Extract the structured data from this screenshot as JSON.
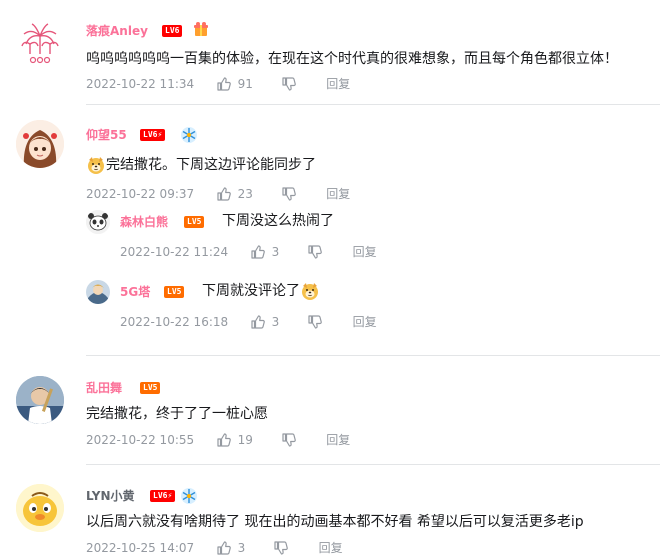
{
  "colors": {
    "username_pink": "#fb7299",
    "username_grey": "#61666d",
    "meta": "#9499a0",
    "lv6": "#ff0000",
    "lv5": "#ff6c00"
  },
  "comments": [
    {
      "user": "落痕Anley",
      "level": "LV6",
      "text": "呜呜呜呜呜呜一百集的体验，在现在这个时代真的很难想象，而且每个角色都很立体！",
      "time": "2022-10-22 11:34",
      "likes": "91",
      "reply": "回复"
    },
    {
      "user": "仰望55",
      "level": "LV6",
      "text": "完结撒花。下周这边评论能同步了",
      "time": "2022-10-22 09:37",
      "likes": "23",
      "reply": "回复",
      "replies": [
        {
          "user": "森林白熊",
          "level": "LV5",
          "text": "下周没这么热闹了",
          "time": "2022-10-22 11:24",
          "likes": "3",
          "reply": "回复"
        },
        {
          "user": "5G塔",
          "level": "LV5",
          "text": "下周就没评论了",
          "time": "2022-10-22 16:18",
          "likes": "3",
          "reply": "回复"
        }
      ]
    },
    {
      "user": "乱田舞",
      "level": "LV5",
      "text": "完结撒花，终于了了一桩心愿",
      "time": "2022-10-22 10:55",
      "likes": "19",
      "reply": "回复"
    },
    {
      "user": "LYN小黄",
      "level": "LV6",
      "text": "以后周六就没有啥期待了 现在出的动画基本都不好看 希望以后可以复活更多老ip",
      "time": "2022-10-25 14:07",
      "likes": "3",
      "reply": "回复"
    }
  ]
}
